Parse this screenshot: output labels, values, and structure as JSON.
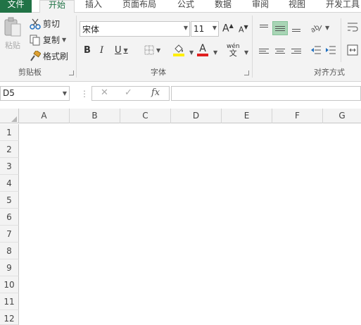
{
  "menu": {
    "tabs": [
      {
        "label": "文件"
      },
      {
        "label": "开始"
      },
      {
        "label": "插入"
      },
      {
        "label": "页面布局"
      },
      {
        "label": "公式"
      },
      {
        "label": "数据"
      },
      {
        "label": "审阅"
      },
      {
        "label": "视图"
      },
      {
        "label": "开发工具"
      }
    ]
  },
  "ribbon": {
    "clipboard": {
      "paste_label": "粘贴",
      "cut_label": "剪切",
      "copy_label": "复制",
      "format_painter_label": "格式刷",
      "group_label": "剪贴板"
    },
    "font": {
      "font_name": "宋体",
      "font_size": "11",
      "bold": "B",
      "italic": "I",
      "underline": "U",
      "font_color_glyph": "A",
      "phonetic_glyph": "wén",
      "group_label": "字体"
    },
    "alignment": {
      "group_label": "对齐方式"
    }
  },
  "formula_bar": {
    "name_box": "D5",
    "cancel_glyph": "✕",
    "enter_glyph": "✓",
    "fx_glyph": "fx",
    "formula": ""
  },
  "grid": {
    "columns": [
      "A",
      "B",
      "C",
      "D",
      "E",
      "F",
      "G"
    ],
    "rows": [
      "1",
      "2",
      "3",
      "4",
      "5",
      "6",
      "7",
      "8",
      "9",
      "10",
      "11",
      "12"
    ]
  },
  "colors": {
    "accent": "#217346",
    "selected_align": "#a8d5b5",
    "font_color_bar": "#e02020",
    "highlight_bar": "#ffee00"
  }
}
